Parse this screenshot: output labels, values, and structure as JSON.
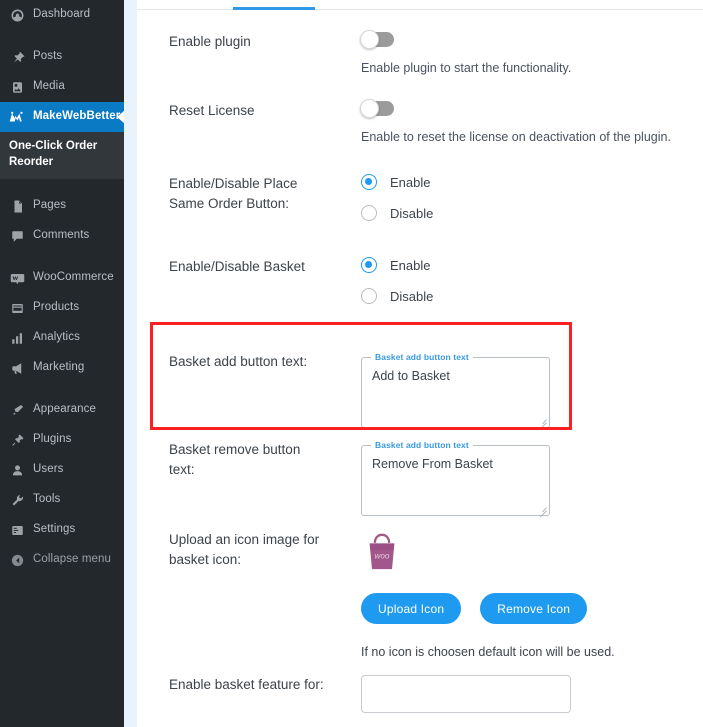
{
  "sidebar": {
    "items": [
      {
        "label": "Dashboard",
        "icon": "dashboard-icon",
        "active": false
      },
      {
        "label": "Posts",
        "icon": "pin-icon",
        "active": false
      },
      {
        "label": "Media",
        "icon": "media-icon",
        "active": false
      },
      {
        "label": "MakeWebBetter",
        "icon": "makewebbetter-icon",
        "active": true
      },
      {
        "label": "Pages",
        "icon": "pages-icon",
        "active": false
      },
      {
        "label": "Comments",
        "icon": "comments-icon",
        "active": false
      },
      {
        "label": "WooCommerce",
        "icon": "woocommerce-icon",
        "active": false
      },
      {
        "label": "Products",
        "icon": "products-icon",
        "active": false
      },
      {
        "label": "Analytics",
        "icon": "analytics-icon",
        "active": false
      },
      {
        "label": "Marketing",
        "icon": "marketing-icon",
        "active": false
      },
      {
        "label": "Appearance",
        "icon": "appearance-icon",
        "active": false
      },
      {
        "label": "Plugins",
        "icon": "plugins-icon",
        "active": false
      },
      {
        "label": "Users",
        "icon": "users-icon",
        "active": false
      },
      {
        "label": "Tools",
        "icon": "tools-icon",
        "active": false
      },
      {
        "label": "Settings",
        "icon": "settings-icon",
        "active": false
      },
      {
        "label": "Collapse menu",
        "icon": "collapse-icon",
        "active": false
      }
    ],
    "submenu_label": "One-Click Order Reorder",
    "active_color": "#0a7ac4",
    "background_color": "#23282d"
  },
  "settings": {
    "enable_plugin": {
      "label": "Enable plugin",
      "toggle_state": "off",
      "help": "Enable plugin to start the functionality."
    },
    "reset_license": {
      "label": "Reset License",
      "toggle_state": "off",
      "help": "Enable to reset the license on deactivation of the plugin."
    },
    "place_same_order": {
      "label": "Enable/Disable Place Same Order Button:",
      "options": [
        {
          "label": "Enable",
          "selected": true
        },
        {
          "label": "Disable",
          "selected": false
        }
      ]
    },
    "enable_basket": {
      "label": "Enable/Disable Basket",
      "options": [
        {
          "label": "Enable",
          "selected": true
        },
        {
          "label": "Disable",
          "selected": false
        }
      ]
    },
    "basket_add_button_text": {
      "label": "Basket add button text:",
      "field_legend": "Basket add button text",
      "value": "Add to Basket"
    },
    "basket_remove_button_text": {
      "label": "Basket remove button text:",
      "field_legend": "Basket add button text",
      "value": "Remove From Basket"
    },
    "upload_icon": {
      "label": "Upload an icon image for basket icon:",
      "icon_name": "woocommerce-bag-icon",
      "upload_button": "Upload Icon",
      "remove_button": "Remove Icon",
      "note": "If no icon is choosen default icon will be used."
    },
    "enable_basket_feature_for": {
      "label": "Enable basket feature for:",
      "value": ""
    }
  },
  "annotation": {
    "color": "#fc2020",
    "target": "basket-add-button-text-row"
  },
  "theme": {
    "accent_blue": "#1e9bf0",
    "tab_underline": "#2e9ae8",
    "rail_blue": "#e8f3fc",
    "legend_blue": "#3a9ae0"
  }
}
